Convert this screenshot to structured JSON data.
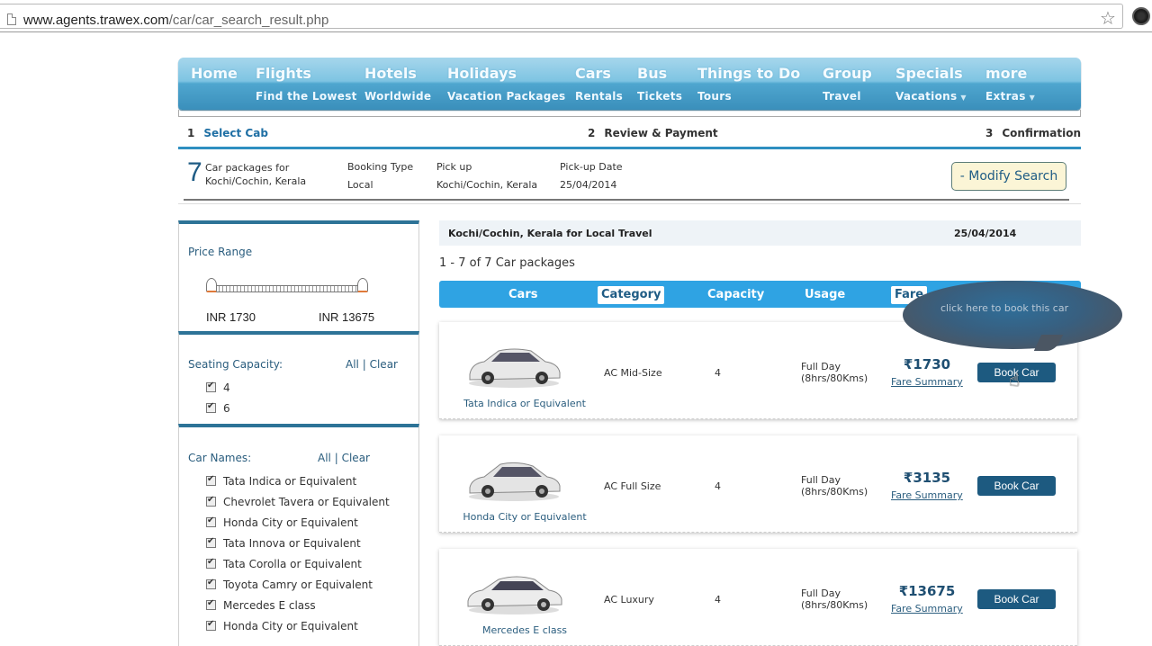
{
  "browser": {
    "url_host": "www.agents.trawex.com",
    "url_path": "/car/car_search_result.php",
    "icons": {
      "page": "page-icon",
      "bookmark": "star-icon",
      "extension": "extension-icon"
    }
  },
  "nav": {
    "items": [
      {
        "main": "Home",
        "sub": ""
      },
      {
        "main": "Flights",
        "sub": "Find the Lowest"
      },
      {
        "main": "Hotels",
        "sub": "Worldwide"
      },
      {
        "main": "Holidays",
        "sub": "Vacation Packages"
      },
      {
        "main": "Cars",
        "sub": "Rentals"
      },
      {
        "main": "Bus",
        "sub": "Tickets"
      },
      {
        "main": "Things to Do",
        "sub": "Tours"
      },
      {
        "main": "Group",
        "sub": "Travel"
      },
      {
        "main": "Specials",
        "sub": "Vacations"
      },
      {
        "main": "more",
        "sub": "Extras"
      }
    ],
    "caret": "▼"
  },
  "steps": [
    {
      "num": "1",
      "label": "Select Cab",
      "active": true
    },
    {
      "num": "2",
      "label": "Review & Payment",
      "active": false
    },
    {
      "num": "3",
      "label": "Confirmation",
      "active": false
    }
  ],
  "summary": {
    "count": "7",
    "text_line1": "Car packages for",
    "text_line2": "Kochi/Cochin, Kerala",
    "booking_type_label": "Booking Type",
    "booking_type_value": "Local",
    "pickup_label": "Pick up",
    "pickup_value": "Kochi/Cochin, Kerala",
    "pickup_date_label": "Pick-up Date",
    "pickup_date_value": "25/04/2014",
    "modify_button": "- Modify Search"
  },
  "filters": {
    "price": {
      "title": "Price Range",
      "min": "INR 1730",
      "max": "INR 13675",
      "selected_min_fraction": 0,
      "selected_max_fraction": 1
    },
    "seating": {
      "title": "Seating Capacity:",
      "all": "All",
      "sep": "|",
      "clear": "Clear",
      "options": [
        {
          "label": "4",
          "checked": true
        },
        {
          "label": "6",
          "checked": true
        }
      ]
    },
    "car_names": {
      "title": "Car Names:",
      "all": "All",
      "sep": "|",
      "clear": "Clear",
      "options": [
        {
          "label": "Tata Indica or Equivalent",
          "checked": true
        },
        {
          "label": "Chevrolet Tavera or Equivalent",
          "checked": true
        },
        {
          "label": "Honda City or Equivalent",
          "checked": true
        },
        {
          "label": "Tata Innova or Equivalent",
          "checked": true
        },
        {
          "label": "Tata Corolla or Equivalent",
          "checked": true
        },
        {
          "label": "Toyota Camry or Equivalent",
          "checked": true
        },
        {
          "label": "Mercedes E class",
          "checked": true
        },
        {
          "label": "Honda City or Equivalent",
          "checked": true
        }
      ]
    }
  },
  "results": {
    "header_left": "Kochi/Cochin, Kerala for Local Travel",
    "header_right": "25/04/2014",
    "count_text": "1 - 7 of 7 Car packages",
    "sort": [
      {
        "label": "Cars",
        "active": false
      },
      {
        "label": "Category",
        "active": true
      },
      {
        "label": "Capacity",
        "active": false
      },
      {
        "label": "Usage",
        "active": false
      },
      {
        "label": "Fare",
        "active": true
      }
    ],
    "tooltip": "click here to book this car",
    "cars": [
      {
        "name": "Tata Indica or Equivalent",
        "category": "AC Mid-Size",
        "capacity": "4",
        "usage_line1": "Full Day",
        "usage_line2": "(8hrs/80Kms)",
        "price": "₹1730",
        "fare_link": "Fare Summary",
        "book": "Book Car",
        "color": "#e8e8e8"
      },
      {
        "name": "Honda City or Equivalent",
        "category": "AC Full Size",
        "capacity": "4",
        "usage_line1": "Full Day",
        "usage_line2": "(8hrs/80Kms)",
        "price": "₹3135",
        "fare_link": "Fare Summary",
        "book": "Book Car",
        "color": "#e4e4e4"
      },
      {
        "name": "Mercedes E class",
        "category": "AC Luxury",
        "capacity": "4",
        "usage_line1": "Full Day",
        "usage_line2": "(8hrs/80Kms)",
        "price": "₹13675",
        "fare_link": "Fare Summary",
        "book": "Book Car",
        "color": "#ececec"
      }
    ]
  },
  "colors": {
    "brand_blue": "#1d5a80",
    "sort_bar": "#2fa3e3",
    "step_accent": "#2e8fc0",
    "modify_bg": "#fbf5d6"
  }
}
